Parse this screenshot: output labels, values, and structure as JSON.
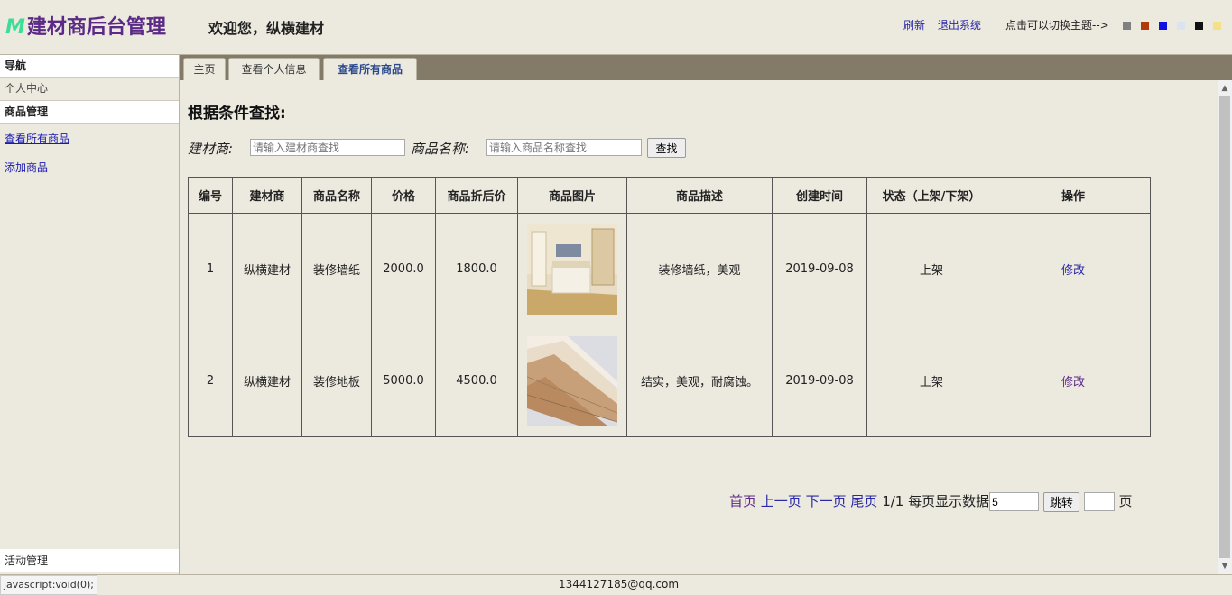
{
  "header": {
    "logo_mark": "M",
    "logo_text": "建材商后台管理",
    "welcome": "欢迎您，纵横建材",
    "refresh": "刷新",
    "logout": "退出系统",
    "theme_hint": "点击可以切换主题-->",
    "theme_colors": [
      "#808080",
      "#b03a0a",
      "#1010e0",
      "#d8e4f0",
      "#111111",
      "#f5e08a"
    ]
  },
  "sidebar": {
    "nav_title": "导航",
    "personal_center": "个人中心",
    "goods_manage": "商品管理",
    "view_all_goods": "查看所有商品",
    "add_goods": "添加商品",
    "activity_manage": "活动管理"
  },
  "tabs": [
    {
      "label": "主页",
      "active": false
    },
    {
      "label": "查看个人信息",
      "active": false
    },
    {
      "label": "查看所有商品",
      "active": true
    }
  ],
  "search": {
    "title": "根据条件查找:",
    "supplier_label": "建材商:",
    "supplier_placeholder": "请输入建材商查找",
    "name_label": "商品名称:",
    "name_placeholder": "请输入商品名称查找",
    "button": "查找"
  },
  "table": {
    "headers": [
      "编号",
      "建材商",
      "商品名称",
      "价格",
      "商品折后价",
      "商品图片",
      "商品描述",
      "创建时间",
      "状态（上架/下架）",
      "操作"
    ],
    "rows": [
      {
        "id": "1",
        "supplier": "纵横建材",
        "name": "装修墙纸",
        "price": "2000.0",
        "discount": "1800.0",
        "image": "bedroom-wallpaper-photo",
        "desc": "装修墙纸，美观",
        "created": "2019-09-08",
        "status": "上架",
        "action": "修改"
      },
      {
        "id": "2",
        "supplier": "纵横建材",
        "name": "装修地板",
        "price": "5000.0",
        "discount": "4500.0",
        "image": "wood-floor-planks-photo",
        "desc": "结实，美观，耐腐蚀。",
        "created": "2019-09-08",
        "status": "上架",
        "action": "修改"
      }
    ]
  },
  "pager": {
    "first": "首页",
    "prev": "上一页",
    "next": "下一页",
    "last": "尾页",
    "page_info": "1/1",
    "per_page_label": "每页显示数据",
    "per_page_value": "5",
    "jump_button": "跳转",
    "page_suffix": "页"
  },
  "footer": {
    "email": "1344127185@qq.com",
    "status_url": "javascript:void(0);"
  }
}
